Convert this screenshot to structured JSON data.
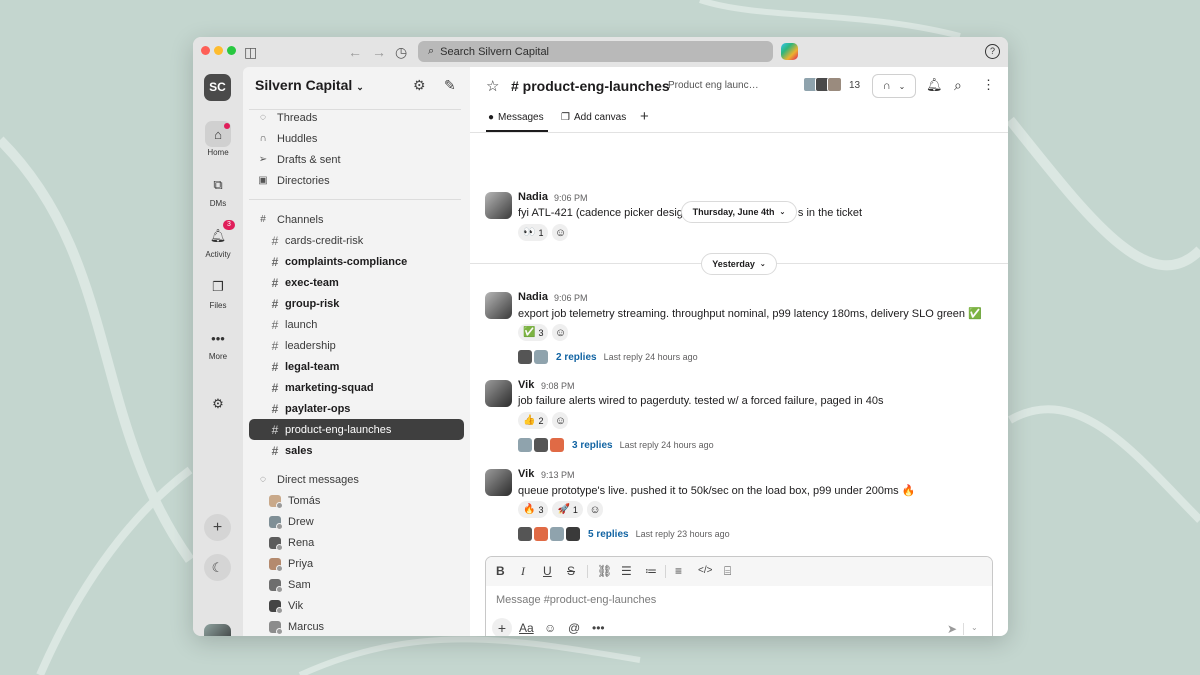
{
  "browser": {
    "search_placeholder": "Search Silvern Capital"
  },
  "workspace": {
    "initials": "SC",
    "name": "Silvern Capital"
  },
  "rail": {
    "items": [
      {
        "label": "Home",
        "icon": "home-icon"
      },
      {
        "label": "DMs",
        "icon": "dms-icon"
      },
      {
        "label": "Activity",
        "icon": "bell-icon",
        "badge": "3"
      },
      {
        "label": "Files",
        "icon": "files-icon"
      },
      {
        "label": "More",
        "icon": "more-icon"
      }
    ]
  },
  "sidebar": {
    "nav": [
      {
        "label": "Threads",
        "icon": "threads-icon"
      },
      {
        "label": "Huddles",
        "icon": "headphones-icon"
      },
      {
        "label": "Drafts & sent",
        "icon": "send-icon"
      },
      {
        "label": "Directories",
        "icon": "directory-icon"
      }
    ],
    "channels_header": "Channels",
    "channels": [
      {
        "name": "cards-credit-risk",
        "bold": false
      },
      {
        "name": "complaints-compliance",
        "bold": true
      },
      {
        "name": "exec-team",
        "bold": true
      },
      {
        "name": "group-risk",
        "bold": true
      },
      {
        "name": "launch",
        "bold": false
      },
      {
        "name": "leadership",
        "bold": false
      },
      {
        "name": "legal-team",
        "bold": true
      },
      {
        "name": "marketing-squad",
        "bold": true
      },
      {
        "name": "paylater-ops",
        "bold": true
      },
      {
        "name": "product-eng-launches",
        "bold": false,
        "selected": true
      },
      {
        "name": "sales",
        "bold": true
      }
    ],
    "dms_header": "Direct messages",
    "dms": [
      {
        "name": "Tomás",
        "color": "#c9a98a"
      },
      {
        "name": "Drew",
        "color": "#7f8f96"
      },
      {
        "name": "Rena",
        "color": "#5c5c5c"
      },
      {
        "name": "Priya",
        "color": "#b48a6e"
      },
      {
        "name": "Sam",
        "color": "#6e6e6e"
      },
      {
        "name": "Vik",
        "color": "#444444"
      },
      {
        "name": "Marcus",
        "color": "#8c8c8c"
      }
    ]
  },
  "channel": {
    "name": "# product-eng-launches",
    "topic": "Product eng launc…",
    "member_count": "13",
    "tabs": [
      {
        "label": "Messages"
      },
      {
        "label": "Add canvas"
      }
    ],
    "composer_placeholder": "Message #product-eng-launches"
  },
  "date_dividers": {
    "first": "Thursday, June 4th",
    "second": "Yesterday"
  },
  "messages": [
    {
      "author": "Nadia",
      "time": "9:06 PM",
      "text": "fyi ATL-421 (cadence picker desig",
      "text_tail": "s in the ticket",
      "reactions": [
        {
          "emoji": "👀",
          "count": "1"
        }
      ]
    },
    {
      "author": "Nadia",
      "time": "9:06 PM",
      "text": "export job telemetry streaming. throughput nominal, p99 latency 180ms, delivery SLO green ✅",
      "reactions": [
        {
          "emoji": "✅",
          "count": "3"
        }
      ],
      "replies": "2 replies",
      "last_reply": "Last reply 24 hours ago"
    },
    {
      "author": "Vik",
      "time": "9:08 PM",
      "text": "job failure alerts wired to pagerduty. tested w/ a forced failure, paged in 40s",
      "reactions": [
        {
          "emoji": "👍",
          "count": "2"
        }
      ],
      "replies": "3 replies",
      "last_reply": "Last reply 24 hours ago"
    },
    {
      "author": "Vik",
      "time": "9:13 PM",
      "text": "queue prototype's live. pushed it to 50k/sec on the load box, p99 under 200ms 🔥",
      "reactions": [
        {
          "emoji": "🔥",
          "count": "3"
        },
        {
          "emoji": "🚀",
          "count": "1"
        }
      ],
      "replies": "5 replies",
      "last_reply": "Last reply 23 hours ago"
    }
  ],
  "colors": {
    "selected_channel_bg": "#3f3f3f",
    "link_blue": "#1264a3",
    "badge_red": "#e01e5a"
  }
}
